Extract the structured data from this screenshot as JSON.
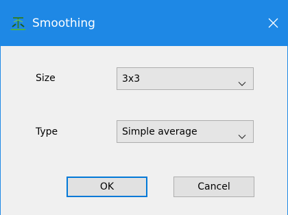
{
  "window": {
    "title": "Smoothing"
  },
  "form": {
    "size_label": "Size",
    "size_value": "3x3",
    "type_label": "Type",
    "type_value": "Simple average"
  },
  "buttons": {
    "ok_label": "OK",
    "cancel_label": "Cancel"
  },
  "colors": {
    "titlebar": "#1e88e5",
    "dialog_background": "#f0f0f0",
    "default_button_border": "#0078d7"
  },
  "icons": {
    "app": "app-logo-icon",
    "close": "close-icon",
    "dropdown": "chevron-down-icon"
  }
}
